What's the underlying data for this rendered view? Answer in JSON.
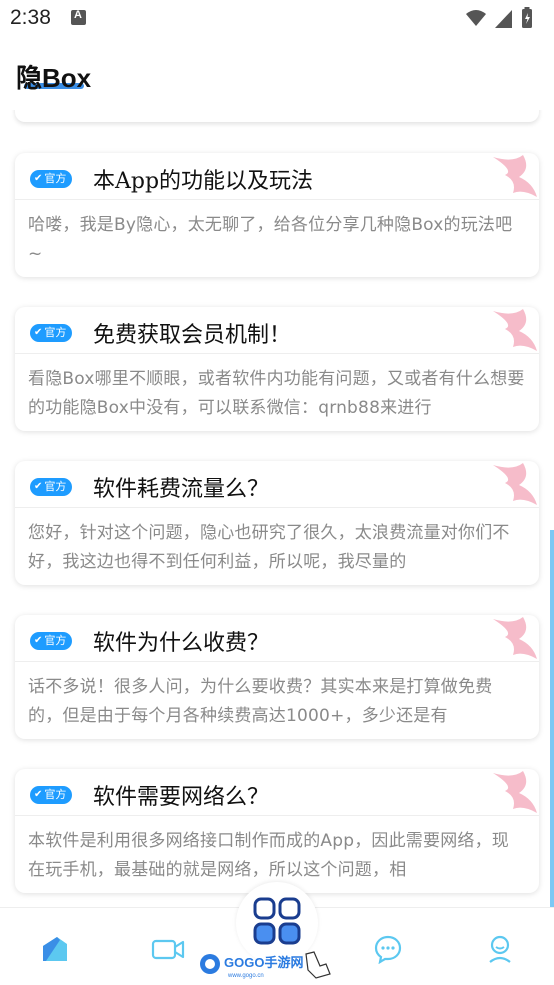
{
  "status_bar": {
    "time": "2:38"
  },
  "header": {
    "title": "隐Box"
  },
  "cards": [
    {
      "badge": "官方",
      "title": "本App的功能以及玩法",
      "excerpt": "哈喽，我是By隐心，太无聊了，给各位分享几种隐Box的玩法吧~"
    },
    {
      "badge": "官方",
      "title": "免费获取会员机制！",
      "excerpt": "看隐Box哪里不顺眼，或者软件内功能有问题，又或者有什么想要的功能隐Box中没有，可以联系微信：qrnb88来进行"
    },
    {
      "badge": "官方",
      "title": "软件耗费流量么？",
      "excerpt": "您好，针对这个问题，隐心也研究了很久，太浪费流量对你们不好，我这边也得不到任何利益，所以呢，我尽量的"
    },
    {
      "badge": "官方",
      "title": "软件为什么收费？",
      "excerpt": "话不多说！很多人问，为什么要收费？其实本来是打算做免费的，但是由于每个月各种续费高达1000+，多少还是有"
    },
    {
      "badge": "官方",
      "title": "软件需要网络么？",
      "excerpt": "本软件是利用很多网络接口制作而成的App，因此需要网络，现在玩手机，最基础的就是网络，所以这个问题，相"
    }
  ],
  "tabs": [
    {
      "icon": "home-icon",
      "active": true
    },
    {
      "icon": "video-icon",
      "active": false
    },
    {
      "icon": "apps-grid-icon",
      "active": false
    },
    {
      "icon": "chat-bubble-icon",
      "active": false
    },
    {
      "icon": "profile-icon",
      "active": false
    }
  ],
  "watermark": {
    "brand": "GOGO手游网",
    "url": "www.gogo.cn"
  },
  "colors": {
    "accent": "#1e9cff",
    "icon_blue": "#3a8ee6",
    "tab_cyan": "#5cc8f0",
    "excerpt_gray": "#8a8a8a"
  }
}
